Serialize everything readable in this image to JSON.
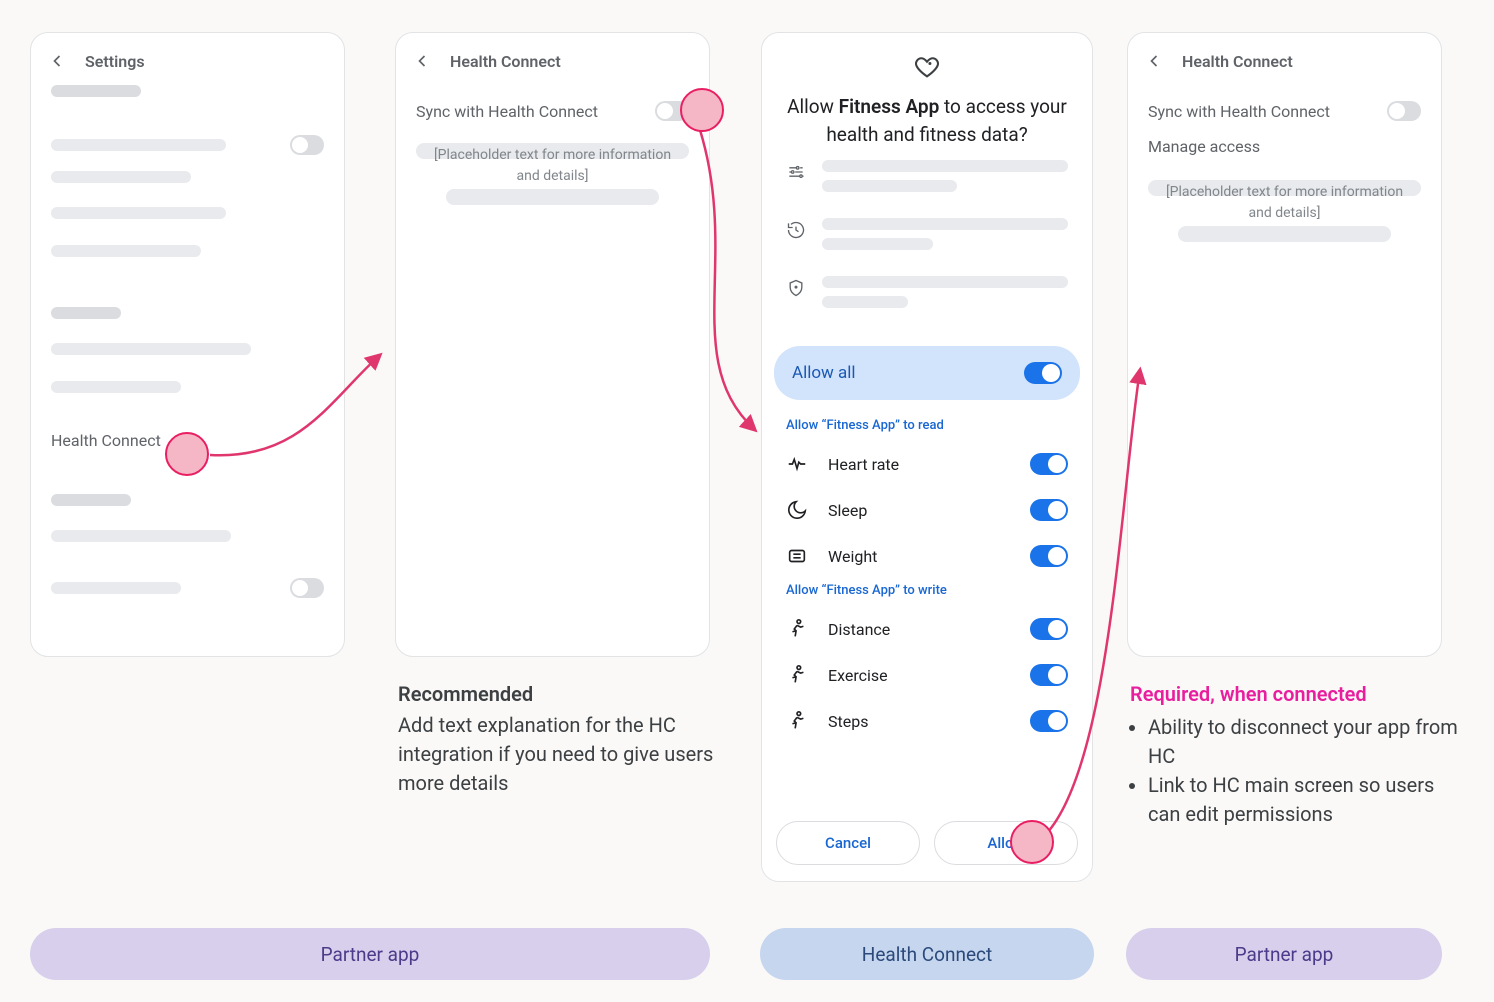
{
  "screen1": {
    "title": "Settings",
    "hc_label": "Health Connect"
  },
  "screen2": {
    "title": "Health Connect",
    "sync_label": "Sync with Health Connect",
    "placeholder": "[Placeholder text for more information and details]"
  },
  "screen3": {
    "title_pre": "Allow ",
    "title_bold": "Fitness App",
    "title_post": " to access your health and fitness data?",
    "allow_all": "Allow all",
    "read_label": "Allow “Fitness App” to read",
    "write_label": "Allow “Fitness App” to write",
    "perm_read": {
      "heart": "Heart rate",
      "sleep": "Sleep",
      "weight": "Weight"
    },
    "perm_write": {
      "distance": "Distance",
      "exercise": "Exercise",
      "steps": "Steps"
    },
    "cancel": "Cancel",
    "allow": "Allow"
  },
  "screen4": {
    "title": "Health Connect",
    "sync_label": "Sync with Health Connect",
    "manage_label": "Manage access",
    "placeholder": "[Placeholder text for more information and details]"
  },
  "captions": {
    "rec_head": "Recommended",
    "rec_body": "Add text explanation for the HC integration if you need to give users more details",
    "req_head": "Required, when connected",
    "req_b1": "Ability to disconnect your app from HC",
    "req_b2": "Link to HC main screen so users can edit permissions"
  },
  "pills": {
    "partner": "Partner app",
    "hc": "Health Connect"
  }
}
